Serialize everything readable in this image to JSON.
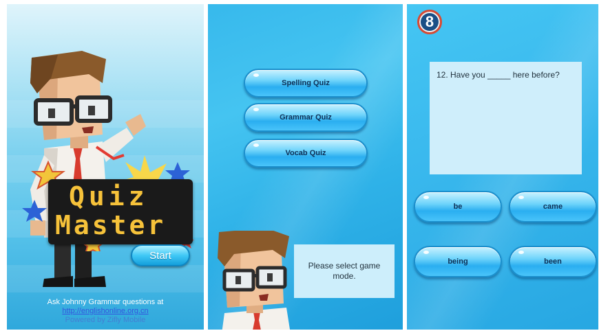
{
  "splash": {
    "logo_line1": "Quiz",
    "logo_line2": "Master",
    "start_label": "Start",
    "footer_text": "Ask Johnny Grammar questions at",
    "footer_link": "http://englishonline.org.cn",
    "footer_powered": "Powered by Zifly Mobile"
  },
  "mode_select": {
    "modes": [
      "Spelling Quiz",
      "Grammar Quiz",
      "Vocab Quiz"
    ],
    "prompt": "Please select game mode."
  },
  "question": {
    "timer": "8",
    "text": "12. Have you _____ here before?",
    "answers": [
      "be",
      "came",
      "being",
      "been"
    ]
  },
  "colors": {
    "accent": "#2aaef0",
    "timer_ring": "#d84a33",
    "logo_dots": "#f6c23a"
  }
}
